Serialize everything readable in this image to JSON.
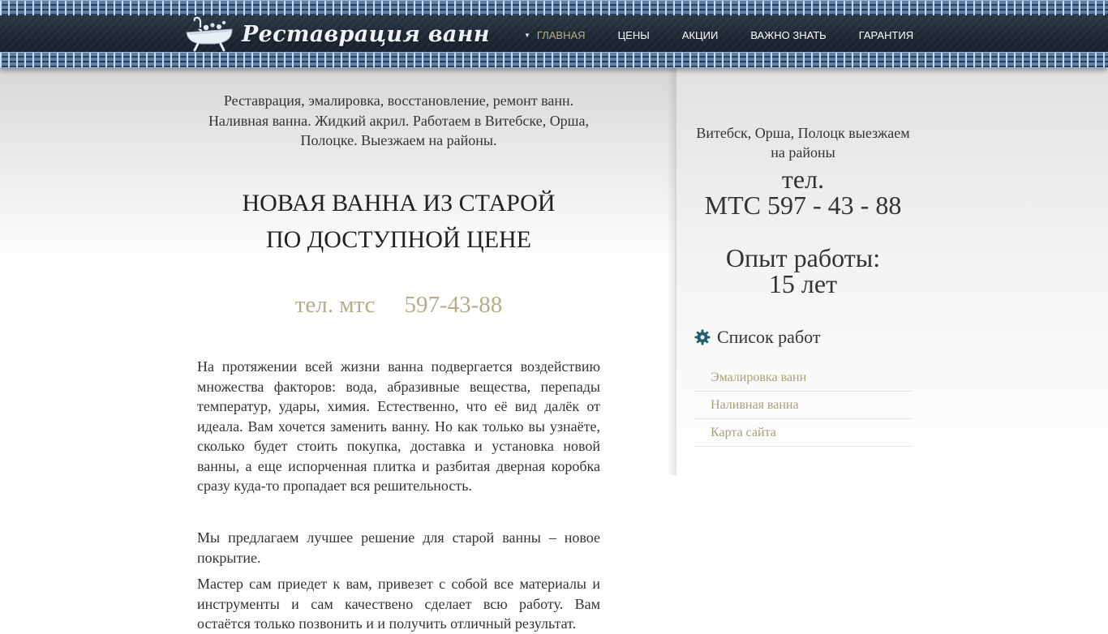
{
  "site": {
    "title": "Реставрация ванн"
  },
  "nav": {
    "items": [
      {
        "label": "ГЛАВНАЯ"
      },
      {
        "label": "ЦЕНЫ"
      },
      {
        "label": "АКЦИИ"
      },
      {
        "label": "ВАЖНО ЗНАТЬ"
      },
      {
        "label": "ГАРАНТИЯ"
      }
    ]
  },
  "main": {
    "intro": "Реставрация, эмалировка, восстановление, ремонт ванн. Наливная ванна. Жидкий акрил. Работаем в Витебске, Орша, Полоцке. Выезжаем на районы.",
    "headline_line1": "НОВАЯ ВАННА ИЗ СТАРОЙ",
    "headline_line2": "ПО ДОСТУПНОЙ ЦЕНЕ",
    "phone_label": "тел. мтс",
    "phone_number": "597-43-88",
    "paragraphs": [
      "На протяжении всей жизни ванна подвергается воздействию множества факторов: вода, абразивные вещества, перепады температур, удары, химия. Естественно, что её вид далёк от идеала. Вам хочется заменить ванну. Но как только вы узнаёте, сколько будет стоить покупка, доставка и установка новой ванны, а еще испорченная плитка и разбитая дверная коробка сразу куда-то пропадает вся решительность.",
      "Мы предлагаем лучшее решение для старой ванны – новое покрытие.",
      "Мастер сам приедет к вам, привезет с собой все материалы и инструменты и сам качествено сделает всю работу. Вам остаётся только позвонить и и получить отличный результат."
    ]
  },
  "sidebar": {
    "cities": "Витебск, Орша, Полоцк выезжаем на районы",
    "tel_label": "тел.",
    "tel_number": "МТС 597 - 43 - 88",
    "exp_label": "Опыт работы:",
    "exp_value": "15 лет",
    "list_title": "Список работ",
    "list": [
      {
        "label": "Эмалировка ванн"
      },
      {
        "label": "Наливная ванна"
      },
      {
        "label": "Карта сайта"
      }
    ]
  },
  "colors": {
    "header": "#1f2a36",
    "accent": "#b5ab86",
    "link": "#a8a07c",
    "gear": "#1f5f6e"
  }
}
